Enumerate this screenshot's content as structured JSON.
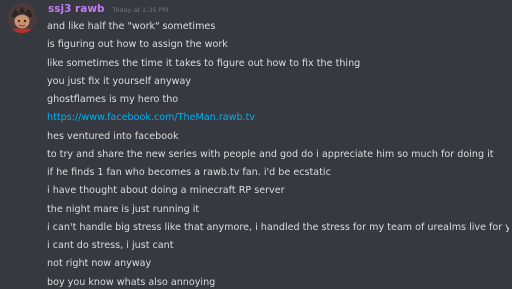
{
  "message": {
    "username": "ssj3 rawb",
    "timestamp": "Today at 1:35 PM",
    "colors": {
      "username": "#c27cf6",
      "background": "#36393f",
      "text": "#dcddde",
      "link": "#00b0f4",
      "timestamp": "#72767d"
    },
    "avatar_icon": "user-avatar-icon",
    "lines": [
      "and like half the \"work\" sometimes",
      "is figuring out how to assign the work",
      "like sometimes the time it takes to figure out how to fix the thing",
      "you just fix it yourself anyway",
      "ghostflames is my hero tho",
      "https://www.facebook.com/TheMan.rawb.tv",
      "hes ventured into facebook",
      "to try and share the new series with people and god do i appreciate him so much for doing it",
      "if he finds 1 fan who becomes a rawb.tv fan. i'd be ecstatic",
      "i have thought about doing a minecraft RP server",
      "the night mare is just running it",
      "i can't handle big stress like that anymore, i handled the stress for my team of urealms live for years",
      "i cant do stress, i just cant",
      "not right now anyway",
      "boy you know whats also annoying"
    ]
  }
}
